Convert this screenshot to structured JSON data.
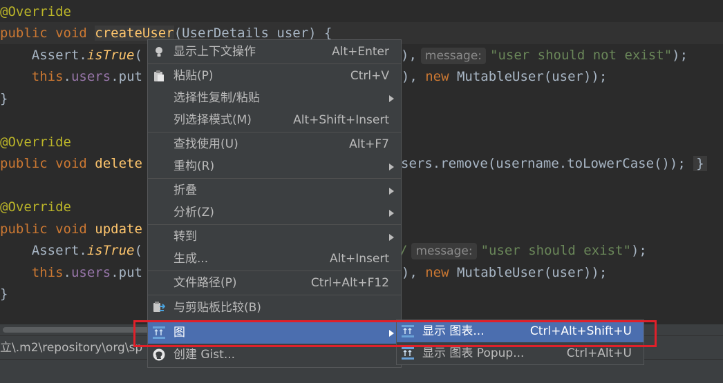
{
  "code": {
    "lines": [
      {
        "t": "@Override"
      },
      {
        "a": "public void ",
        "b": "createUser",
        "c": "(UserDetails user) {"
      },
      {
        "a": "    Assert.",
        "b": "isTrue",
        "c": "(",
        "msg_hint": "message:",
        "str": "\"user should not exist\"",
        "end": ");"
      },
      {
        "a": "    ",
        "b": "this",
        "c": ".",
        "d": "users",
        "e": ".put",
        "f": "e(), ",
        "g": "new",
        "h": " MutableUser(user));"
      },
      {
        "t": "}"
      },
      {
        "t": ""
      },
      {
        "t": "@Override"
      },
      {
        "a": "public void ",
        "b": "delete",
        "c": "sers.remove(username.toLowerCase());",
        "end": "}"
      },
      {
        "t": ""
      },
      {
        "t": "@Override"
      },
      {
        "a": "public void ",
        "b": "update"
      },
      {
        "a": "    Assert.",
        "b": "isTrue",
        "c": "(",
        "slash": "/",
        "msg_hint": "message:",
        "str": "\"user should exist\"",
        "end": ");"
      },
      {
        "a": "    ",
        "b": "this",
        "c": ".",
        "d": "users",
        "e": ".put",
        "f": "e(), ",
        "g": "new",
        "h": " MutableUser(user));"
      },
      {
        "t": "}"
      }
    ],
    "lines_right_partial": {
      "line2_pre": "),"
    }
  },
  "status": {
    "path": "立\\.m2\\repository\\org\\sp"
  },
  "context_menu": {
    "items": [
      {
        "label": "显示上下文操作",
        "shortcut": "Alt+Enter",
        "icon": "bulb-icon"
      },
      {
        "label": "粘贴(P)",
        "shortcut": "Ctrl+V",
        "icon": "clipboard-icon"
      },
      {
        "label": "选择性复制/粘贴",
        "shortcut": "",
        "submenu": true
      },
      {
        "label": "列选择模式(M)",
        "shortcut": "Alt+Shift+Insert"
      },
      {
        "label": "查找使用(U)",
        "shortcut": "Alt+F7"
      },
      {
        "label": "重构(R)",
        "shortcut": "",
        "submenu": true
      },
      {
        "label": "折叠",
        "shortcut": "",
        "submenu": true
      },
      {
        "label": "分析(Z)",
        "shortcut": "",
        "submenu": true
      },
      {
        "label": "转到",
        "shortcut": "",
        "submenu": true
      },
      {
        "label": "生成...",
        "shortcut": "Alt+Insert"
      },
      {
        "label": "文件路径(P)",
        "shortcut": "Ctrl+Alt+F12"
      },
      {
        "label": "与剪贴板比较(B)",
        "shortcut": "",
        "icon": "compare-clipboard-icon"
      },
      {
        "label": "图",
        "shortcut": "",
        "submenu": true,
        "selected": true,
        "icon": "diagram-icon"
      },
      {
        "label": "创建 Gist...",
        "shortcut": "",
        "icon": "github-icon"
      }
    ]
  },
  "submenu": {
    "items": [
      {
        "label": "显示 图表...",
        "shortcut": "Ctrl+Alt+Shift+U",
        "icon": "diagram-icon"
      },
      {
        "label": "显示 图表 Popup...",
        "shortcut": "Ctrl+Alt+U",
        "icon": "diagram-icon"
      }
    ]
  },
  "colors": {
    "accent": "#4b6eaf",
    "highlight_box": "#e0202a",
    "menu_bg": "#3c3f41",
    "editor_bg": "#2b2b2b"
  }
}
